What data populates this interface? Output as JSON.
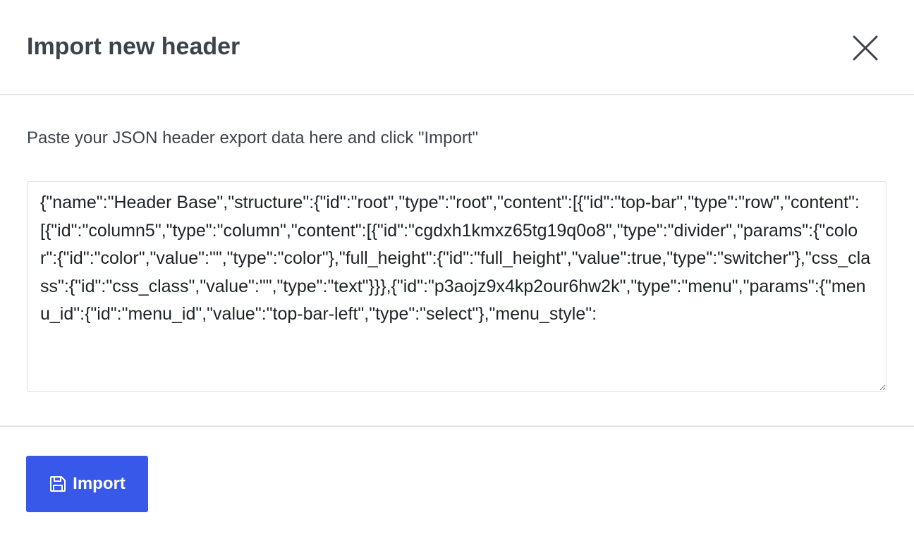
{
  "dialog": {
    "title": "Import new header",
    "close_icon": "close-icon"
  },
  "body": {
    "instructions": "Paste your JSON header export data here and click \"Import\"",
    "json_value": "{\"name\":\"Header Base\",\"structure\":{\"id\":\"root\",\"type\":\"root\",\"content\":[{\"id\":\"top-bar\",\"type\":\"row\",\"content\":[{\"id\":\"column5\",\"type\":\"column\",\"content\":[{\"id\":\"cgdxh1kmxz65tg19q0o8\",\"type\":\"divider\",\"params\":{\"color\":{\"id\":\"color\",\"value\":\"\",\"type\":\"color\"},\"full_height\":{\"id\":\"full_height\",\"value\":true,\"type\":\"switcher\"},\"css_class\":{\"id\":\"css_class\",\"value\":\"\",\"type\":\"text\"}}},{\"id\":\"p3aojz9x4kp2our6hw2k\",\"type\":\"menu\",\"params\":{\"menu_id\":{\"id\":\"menu_id\",\"value\":\"top-bar-left\",\"type\":\"select\"},\"menu_style\":"
  },
  "footer": {
    "import_label": "Import",
    "import_icon": "save-icon"
  },
  "colors": {
    "accent": "#3858e9",
    "text": "#3c434a",
    "divider": "#e3e5e8"
  }
}
